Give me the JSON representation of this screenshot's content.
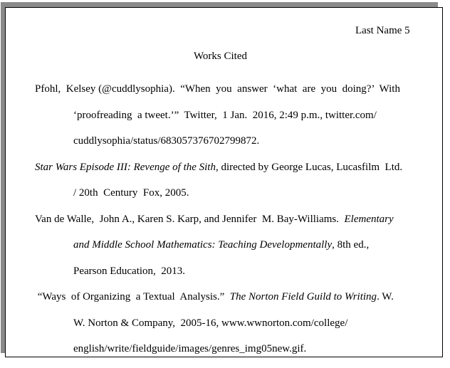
{
  "document": {
    "header": "Last Name 5",
    "title": "Works Cited",
    "entries": [
      {
        "lines": [
          [
            {
              "t": "Pfohl,  Kelsey (@cuddlysophia).  “When  you  answer  ‘what  are  you  doing?’  With"
            }
          ],
          [
            {
              "t": "‘proofreading  a tweet.’”  Twitter,  1 Jan.  2016, 2:49 p.m., twitter.com/"
            }
          ],
          [
            {
              "t": "cuddlysophia/status/683057376702799872."
            }
          ]
        ]
      },
      {
        "lines": [
          [
            {
              "t": "Star Wars Episode III: Revenge of the Sith",
              "i": true
            },
            {
              "t": ", directed by George Lucas, Lucasfilm  Ltd."
            }
          ],
          [
            {
              "t": "/ 20th  Century  Fox, 2005."
            }
          ]
        ]
      },
      {
        "lines": [
          [
            {
              "t": "Van de Walle,  John A., Karen S. Karp, and Jennifer  M. Bay-Williams.  "
            },
            {
              "t": "Elementary",
              "i": true
            }
          ],
          [
            {
              "t": "and Middle School Mathematics: Teaching Developmentally",
              "i": true
            },
            {
              "t": ", 8th ed.,"
            }
          ],
          [
            {
              "t": "Pearson Education,  2013."
            }
          ]
        ]
      },
      {
        "lines": [
          [
            {
              "t": " “Ways  of Organizing  a Textual  Analysis.”  "
            },
            {
              "t": "The Norton Field Guild to Writing",
              "i": true
            },
            {
              "t": ". W."
            }
          ],
          [
            {
              "t": "W. Norton & Company,  2005-16, www.wwnorton.com/college/"
            }
          ],
          [
            {
              "t": "english/write/fieldguide/images/genres_img05new.gif."
            }
          ]
        ]
      }
    ]
  }
}
